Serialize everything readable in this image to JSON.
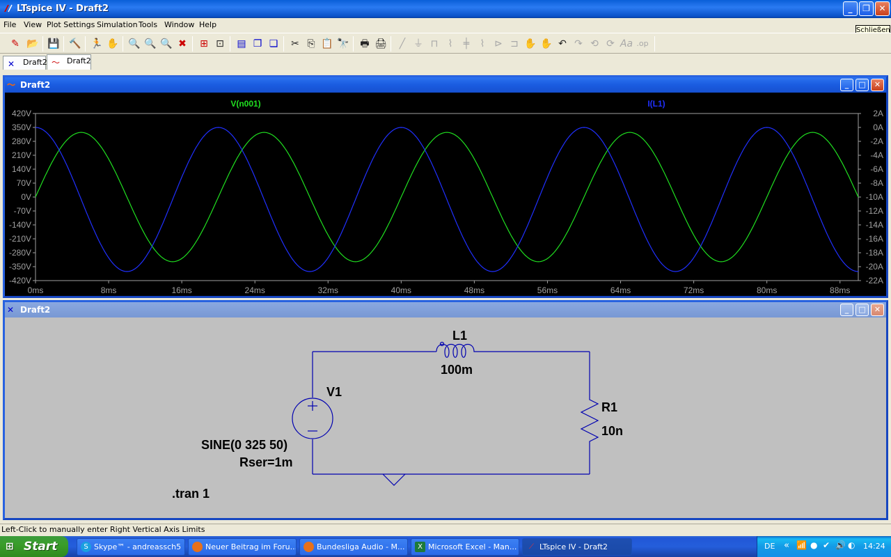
{
  "window": {
    "title": "LTspice IV - Draft2",
    "tooltip": "Schließen"
  },
  "menu": [
    "File",
    "View",
    "Plot Settings",
    "Simulation",
    "Tools",
    "Window",
    "Help"
  ],
  "tabs": [
    {
      "label": "Draft2",
      "icon": "schematic-icon"
    },
    {
      "label": "Draft2",
      "icon": "waveform-icon"
    }
  ],
  "plot_window": {
    "title": "Draft2"
  },
  "schematic_window": {
    "title": "Draft2"
  },
  "chart_data": {
    "type": "line",
    "series": [
      {
        "name": "V(n001)",
        "color": "#00ff00",
        "axis": "left",
        "function": "325*sin(2*pi*50*t)",
        "amplitude": 325,
        "frequency_hz": 50,
        "phase_deg": 0
      },
      {
        "name": "I(L1)",
        "color": "#0000ff",
        "axis": "right",
        "function": "-10.35 + 10.35*cos(2*pi*50*t)",
        "offset_A": -10.35,
        "amplitude_A": 10.35,
        "frequency_hz": 50
      }
    ],
    "x_ticks": [
      "0ms",
      "8ms",
      "16ms",
      "24ms",
      "32ms",
      "40ms",
      "48ms",
      "56ms",
      "64ms",
      "72ms",
      "80ms",
      "88ms"
    ],
    "xlim_ms": [
      0,
      90
    ],
    "left_ticks": [
      "420V",
      "350V",
      "280V",
      "210V",
      "140V",
      "70V",
      "0V",
      "-70V",
      "-140V",
      "-210V",
      "-280V",
      "-350V",
      "-420V"
    ],
    "ylim_left": [
      -420,
      420
    ],
    "right_ticks": [
      "2A",
      "0A",
      "-2A",
      "-4A",
      "-6A",
      "-8A",
      "-10A",
      "-12A",
      "-14A",
      "-16A",
      "-18A",
      "-20A",
      "-22A"
    ],
    "ylim_right": [
      -22,
      2
    ],
    "background": "#000000",
    "grid": false
  },
  "schematic": {
    "inductor_name": "L1",
    "inductor_value": "100m",
    "source_name": "V1",
    "source_value_1": "SINE(0 325 50)",
    "source_value_2": "Rser=1m",
    "resistor_name": "R1",
    "resistor_value": "10n",
    "directive": ".tran 1",
    "wire_color": "#0000b0"
  },
  "status": {
    "text": "Left-Click to manually enter Right Vertical Axis Limits"
  },
  "taskbar": {
    "start": "Start",
    "tasks": [
      {
        "label": "Skype™ - andreassch5",
        "icon": "skype-icon"
      },
      {
        "label": "Neuer Beitrag im Foru...",
        "icon": "firefox-icon"
      },
      {
        "label": "Bundesliga Audio - M...",
        "icon": "firefox-icon"
      },
      {
        "label": "Microsoft Excel - Man...",
        "icon": "excel-icon"
      },
      {
        "label": "LTspice IV - Draft2",
        "icon": "ltspice-icon"
      }
    ],
    "lang": "DE",
    "clock": "14:24"
  }
}
